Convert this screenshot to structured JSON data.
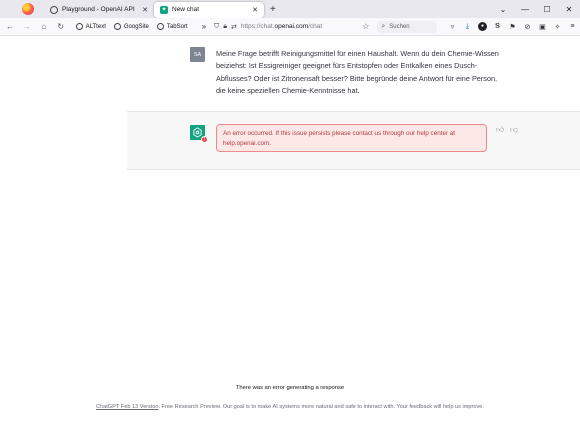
{
  "browser": {
    "tabs": [
      {
        "label": "Playground - OpenAI API",
        "active": false
      },
      {
        "label": "New chat",
        "active": true
      }
    ],
    "bookmarks": [
      "ALTtext",
      "GoogSite",
      "TabSort"
    ],
    "url_scheme": "https://chat.",
    "url_host": "openai.com",
    "url_path": "/chat",
    "search_placeholder": "Suchen"
  },
  "chat": {
    "user_initials": "SA",
    "user_message": "Meine Frage betrifft Reinigungsmittel für einen Haushalt. Wenn du dein Chemie-Wissen beiziehst: Ist Essigreiniger geeignet fürs Entstopfen oder Entkalken eines Dusch-Abflusses? Oder ist Zitronensaft besser? Bitte begründe deine Antwort für eine Person, die keine speziellen Chemie-Kenntnisse hat.",
    "error_message": "An error occurred. If this issue persists please contact us through our help center at help.openai.com."
  },
  "status": {
    "error_banner": "There was an error generating a response"
  },
  "footer": {
    "link_text": "ChatGPT Feb 13 Version",
    "text": ". Free Research Preview. Our goal is to make AI systems more natural and safe to interact with. Your feedback will help us improve."
  },
  "colors": {
    "accent": "#10a37f",
    "error_bg": "#fde8e8",
    "error_border": "#ef8a8a",
    "error_text": "#b23b3b"
  }
}
